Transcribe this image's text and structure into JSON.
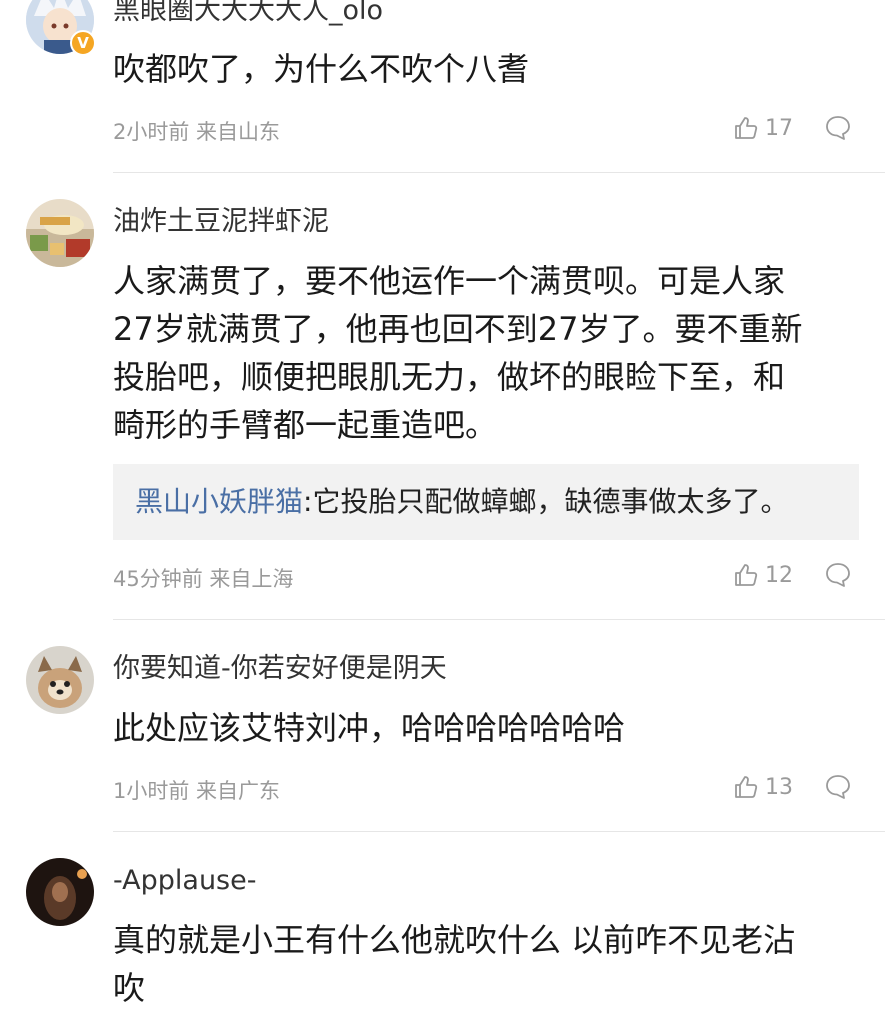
{
  "comments": [
    {
      "username": "黑眼圈大大大大人_olo",
      "content": "吹都吹了，为什么不吹个八耆",
      "meta": "2小时前 来自山东",
      "likes": "17",
      "verified_badge": "V"
    },
    {
      "username": "油炸土豆泥拌虾泥",
      "content_lines": [
        "人家满贯了，要不他运作一个满贯呗。可是人家",
        "27岁就满贯了，他再也回不到27岁了。要不重新",
        "投胎吧，顺便把眼肌无力，做坏的眼睑下至，和",
        "畸形的手臂都一起重造吧。"
      ],
      "sub_reply": {
        "user": "黑山小妖胖猫",
        "separator": ":",
        "text": "它投胎只配做蟑螂，缺德事做太多了。"
      },
      "meta": "45分钟前 来自上海",
      "likes": "12"
    },
    {
      "username": "你要知道-你若安好便是阴天",
      "content": "此处应该艾特刘冲，哈哈哈哈哈哈哈",
      "meta": "1小时前 来自广东",
      "likes": "13"
    },
    {
      "username": "-Applause-",
      "content_lines": [
        "真的就是小王有什么他就吹什么 以前咋不见老沾",
        "吹"
      ]
    }
  ],
  "colors": {
    "link": "#4a6fa5",
    "meta": "#9a9a9a",
    "divider": "#e6e6e6",
    "quote_bg": "#f2f2f2"
  }
}
